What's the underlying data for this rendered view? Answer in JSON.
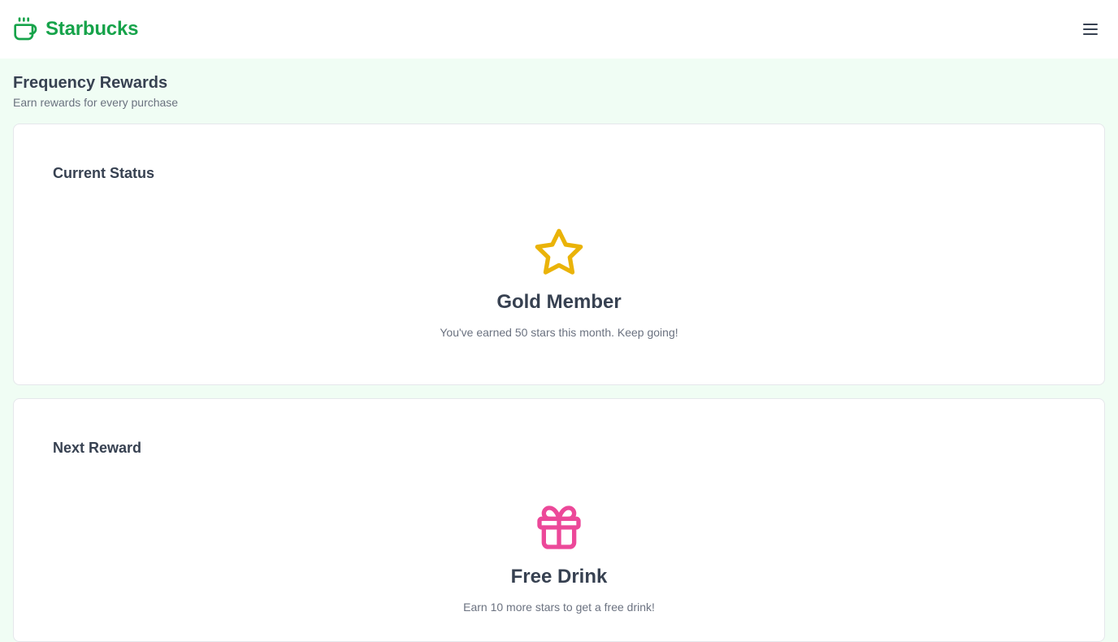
{
  "header": {
    "brand_name": "Starbucks",
    "logo_icon": "coffee-cup-icon",
    "menu_icon": "hamburger-menu-icon"
  },
  "page": {
    "title": "Frequency Rewards",
    "subtitle": "Earn rewards for every purchase"
  },
  "status_card": {
    "title": "Current Status",
    "icon": "star-icon",
    "heading": "Gold Member",
    "text": "You've earned 50 stars this month. Keep going!"
  },
  "reward_card": {
    "title": "Next Reward",
    "icon": "gift-icon",
    "heading": "Free Drink",
    "text": "Earn 10 more stars to get a free drink!"
  },
  "colors": {
    "brand": "#16a34a",
    "background": "#f0fdf4",
    "star": "#eab308",
    "gift": "#ec4899"
  }
}
